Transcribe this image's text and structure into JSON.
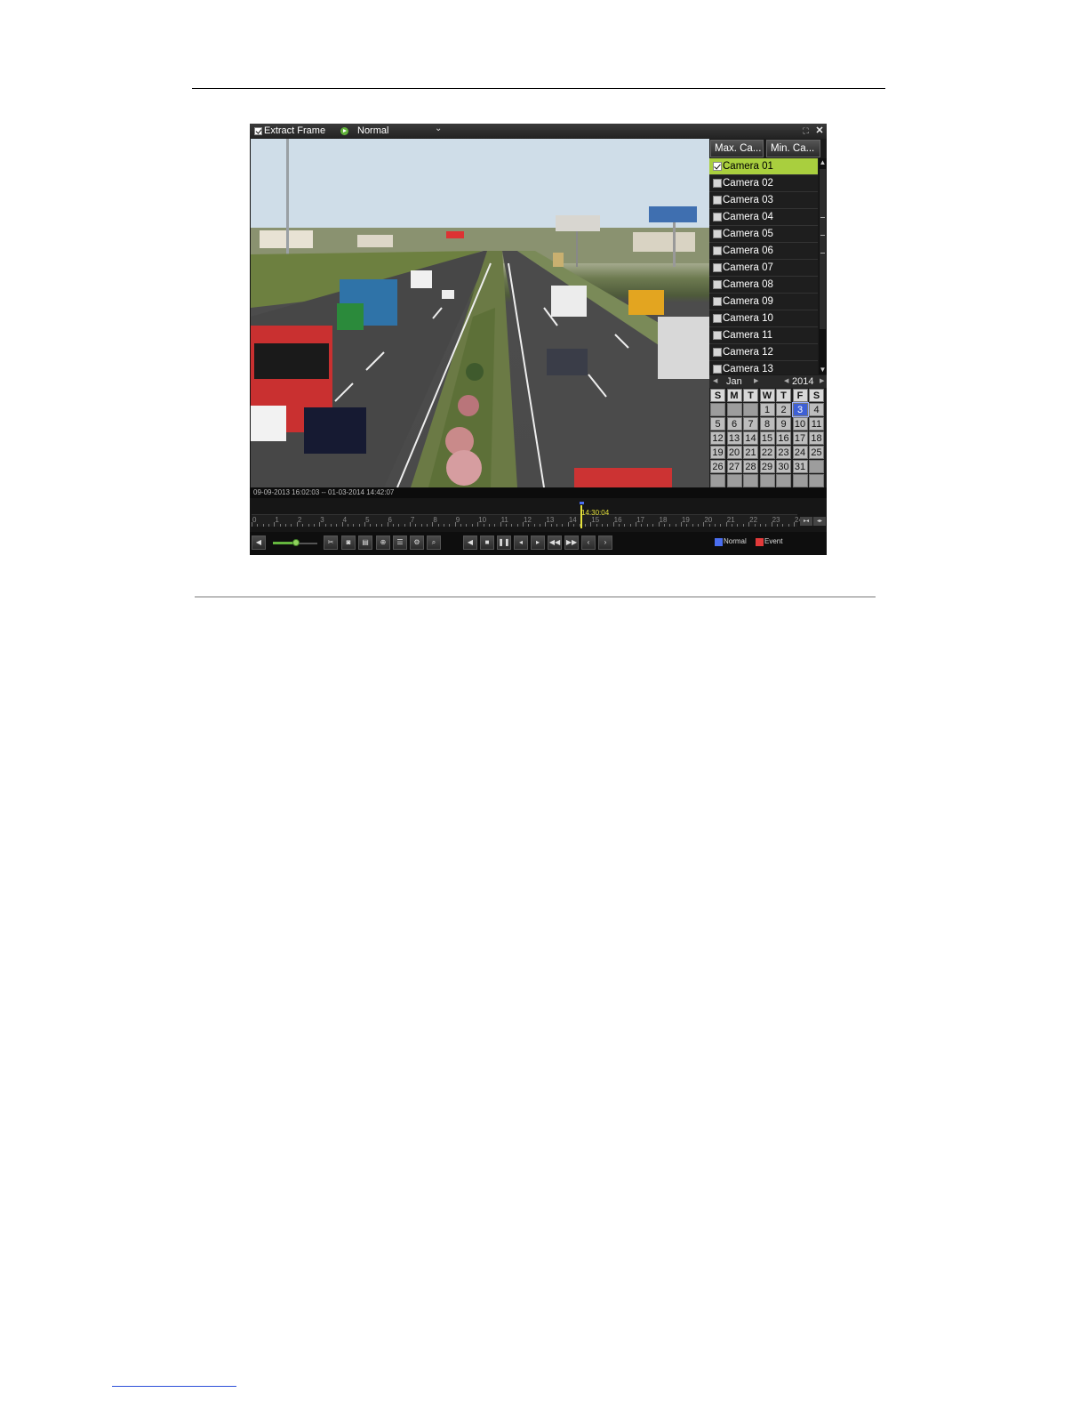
{
  "titlebar": {
    "extract_label": "Extract Frame",
    "mode_label": "Normal",
    "dropdown_glyph": "⌄",
    "fullscreen_glyph": "⛶",
    "close_glyph": "✕"
  },
  "side_panel": {
    "max_button": "Max. Ca...",
    "min_button": "Min. Ca...",
    "cameras": [
      {
        "label": "Camera 01",
        "checked": true
      },
      {
        "label": "Camera 02",
        "checked": false
      },
      {
        "label": "Camera 03",
        "checked": false
      },
      {
        "label": "Camera 04",
        "checked": false
      },
      {
        "label": "Camera 05",
        "checked": false
      },
      {
        "label": "Camera 06",
        "checked": false
      },
      {
        "label": "Camera 07",
        "checked": false
      },
      {
        "label": "Camera 08",
        "checked": false
      },
      {
        "label": "Camera 09",
        "checked": false
      },
      {
        "label": "Camera 10",
        "checked": false
      },
      {
        "label": "Camera 11",
        "checked": false
      },
      {
        "label": "Camera 12",
        "checked": false
      },
      {
        "label": "Camera 13",
        "checked": false
      }
    ]
  },
  "calendar": {
    "month": "Jan",
    "year": "2014",
    "weekdays": [
      "S",
      "M",
      "T",
      "W",
      "T",
      "F",
      "S"
    ],
    "weeks": [
      [
        "",
        "",
        "",
        "1",
        "2",
        "3",
        "4"
      ],
      [
        "5",
        "6",
        "7",
        "8",
        "9",
        "10",
        "11"
      ],
      [
        "12",
        "13",
        "14",
        "15",
        "16",
        "17",
        "18"
      ],
      [
        "19",
        "20",
        "21",
        "22",
        "23",
        "24",
        "25"
      ],
      [
        "26",
        "27",
        "28",
        "29",
        "30",
        "31",
        ""
      ],
      [
        "",
        "",
        "",
        "",
        "",
        "",
        ""
      ]
    ],
    "selected_day": "3"
  },
  "status": {
    "range_text": "09-09-2013 16:02:03 -- 01-03-2014 14:42:07"
  },
  "timeline": {
    "hours": [
      "0",
      "1",
      "2",
      "3",
      "4",
      "5",
      "6",
      "7",
      "8",
      "9",
      "10",
      "11",
      "12",
      "13",
      "14",
      "15",
      "16",
      "17",
      "18",
      "19",
      "20",
      "21",
      "22",
      "23",
      "24"
    ],
    "current_time": "14:30:04"
  },
  "controls": {
    "legend_normal": "Normal",
    "legend_event": "Event",
    "normal_color": "#4a6ef0",
    "event_color": "#e23a3a",
    "volume_level": 0.5
  }
}
